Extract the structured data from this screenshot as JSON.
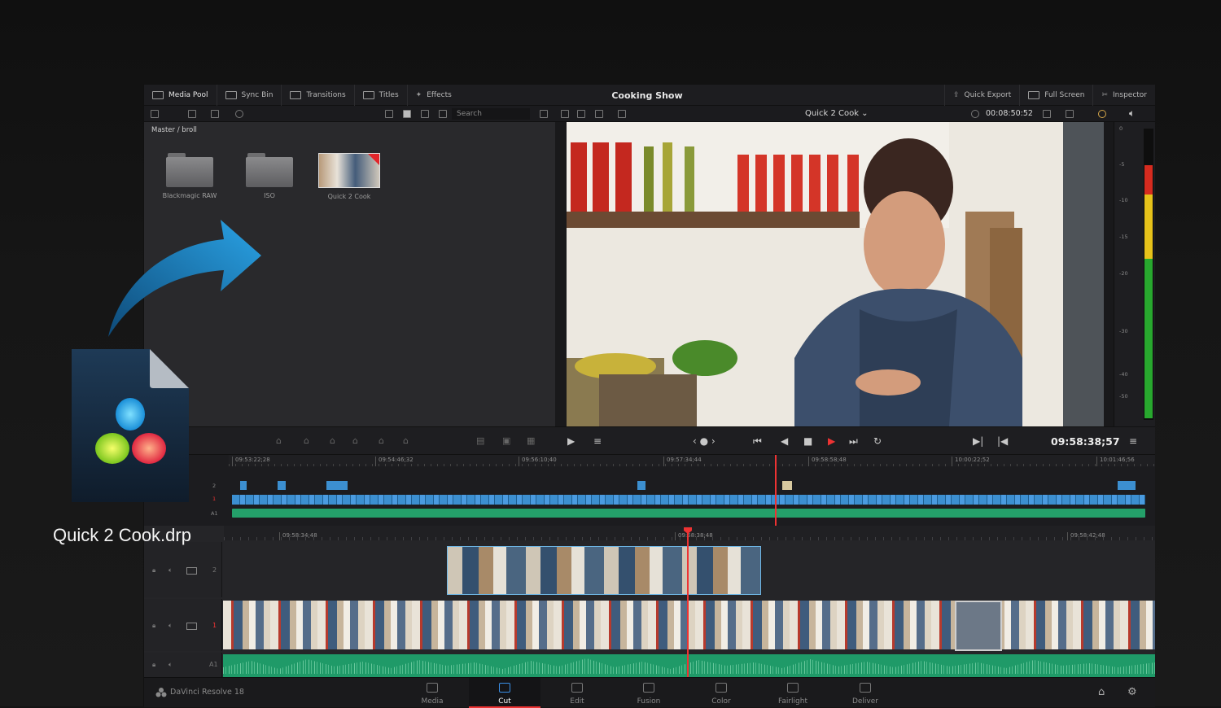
{
  "toolbar": {
    "media_pool": "Media Pool",
    "sync_bin": "Sync Bin",
    "transitions": "Transitions",
    "titles": "Titles",
    "effects": "Effects",
    "project_title": "Cooking Show",
    "quick_export": "Quick Export",
    "full_screen": "Full Screen",
    "inspector": "Inspector"
  },
  "subbar": {
    "search_placeholder": "Search",
    "viewer_clip": "Quick 2 Cook ⌄",
    "viewer_timecode": "00:08:50:52"
  },
  "media_pool": {
    "breadcrumb": "Master / broll",
    "items": [
      {
        "label": "Blackmagic RAW",
        "kind": "folder"
      },
      {
        "label": "ISO",
        "kind": "folder"
      },
      {
        "label": "Quick 2 Cook",
        "kind": "timeline"
      }
    ]
  },
  "meter": {
    "ticks": [
      "0",
      "-5",
      "-10",
      "-15",
      "-20",
      "-30",
      "-40",
      "-50"
    ]
  },
  "transport": {
    "timecode": "09:58:38;57"
  },
  "upper_timeline": {
    "ruler": [
      "09:53:22;28",
      "09:54:46;32",
      "09:56:10;40",
      "09:57:34;44",
      "09:58:58;48",
      "10:00:22;52",
      "10:01:46;56"
    ],
    "tracks": [
      "2",
      "1",
      "A1"
    ]
  },
  "lower_timeline": {
    "ruler": [
      "09:58:34;48",
      "09:58:38;48",
      "09:58:42;48"
    ],
    "tracks": [
      "2",
      "1",
      "A1"
    ]
  },
  "pages": [
    {
      "label": "Media"
    },
    {
      "label": "Cut"
    },
    {
      "label": "Edit"
    },
    {
      "label": "Fusion"
    },
    {
      "label": "Color"
    },
    {
      "label": "Fairlight"
    },
    {
      "label": "Deliver"
    }
  ],
  "brand": "DaVinci Resolve 18",
  "drag_file": {
    "name": "Quick 2 Cook.drp"
  },
  "colors": {
    "accent_red": "#e33333",
    "clip_blue": "#3c8fd0",
    "audio_green": "#24a06a"
  }
}
